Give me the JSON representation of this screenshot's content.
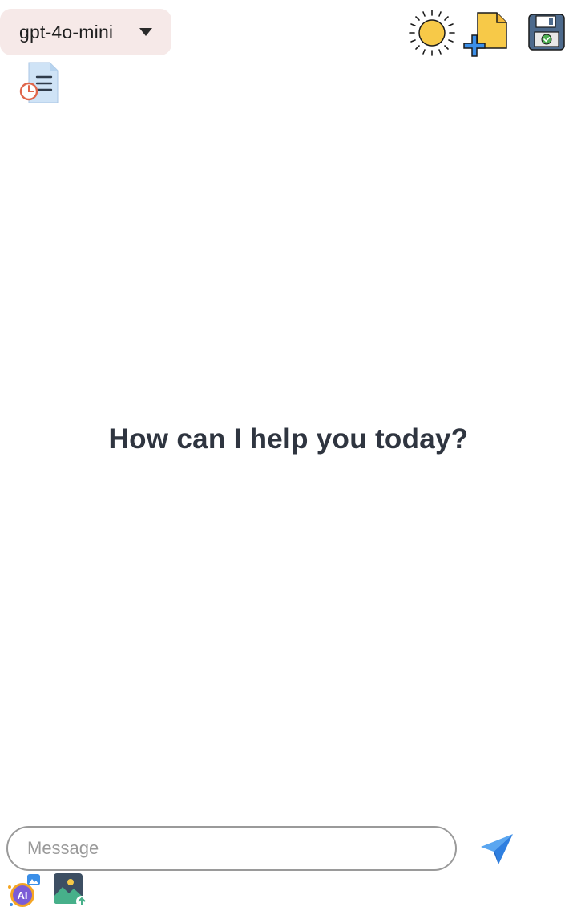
{
  "header": {
    "model_selector": {
      "selected": "gpt-4o-mini"
    },
    "icons": {
      "theme_toggle": "sun-icon",
      "new_chat": "new-document-icon",
      "save_chat": "save-icon",
      "history": "history-icon"
    }
  },
  "main": {
    "greeting": "How can I help you today?"
  },
  "composer": {
    "placeholder": "Message",
    "value": "",
    "icons": {
      "send": "send-icon",
      "ai_image": "ai-image-icon",
      "image_upload": "image-upload-icon"
    }
  },
  "colors": {
    "model_pill_bg": "#f6e9e8",
    "greeting_text": "#2f3540",
    "input_border": "#9a9a9a",
    "send_blue": "#3b8fe8",
    "sun_yellow": "#f7c948"
  }
}
